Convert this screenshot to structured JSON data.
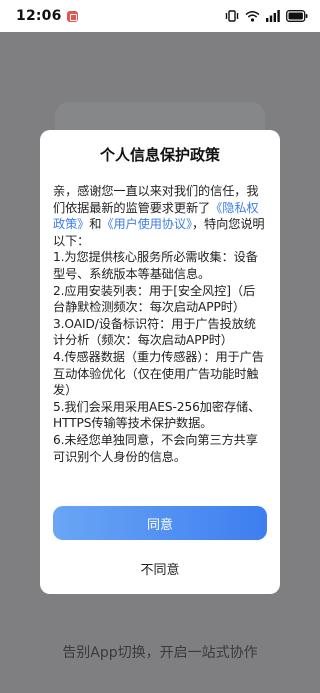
{
  "status_bar": {
    "time": "12:06",
    "icons": [
      "notification-app-icon",
      "vibrate-icon",
      "wifi-icon",
      "cellular-signal-icon",
      "battery-icon"
    ]
  },
  "background": {
    "tagline": "告别App切换，开启一站式协作"
  },
  "dialog": {
    "title": "个人信息保护政策",
    "intro_before": "亲，感谢您一直以来对我们的信任，我们依据最新的监管要求更新了",
    "privacy_link": "《隐私权政策》",
    "and": "和",
    "user_agreement_link": "《用户使用协议》",
    "intro_after": "，特向您说明以下：",
    "items": [
      "1.为您提供核心服务所必需收集：设备型号、系统版本等基础信息。",
      "2.应用安装列表：用于[安全风控]（后台静默检测频次：每次启动APP时）",
      "3.OAID/设备标识符：用于广告投放统计分析（频次：每次启动APP时）",
      "4.传感器数据（重力传感器）：用于广告互动体验优化（仅在使用广告功能时触发）",
      "5.我们会采用采用AES-256加密存储、HTTPS传输等技术保护数据。",
      "6.未经您单独同意，不会向第三方共享可识别个人身份的信息。"
    ],
    "agree_label": "同意",
    "disagree_label": "不同意",
    "accent_color": "#3d7de8"
  }
}
